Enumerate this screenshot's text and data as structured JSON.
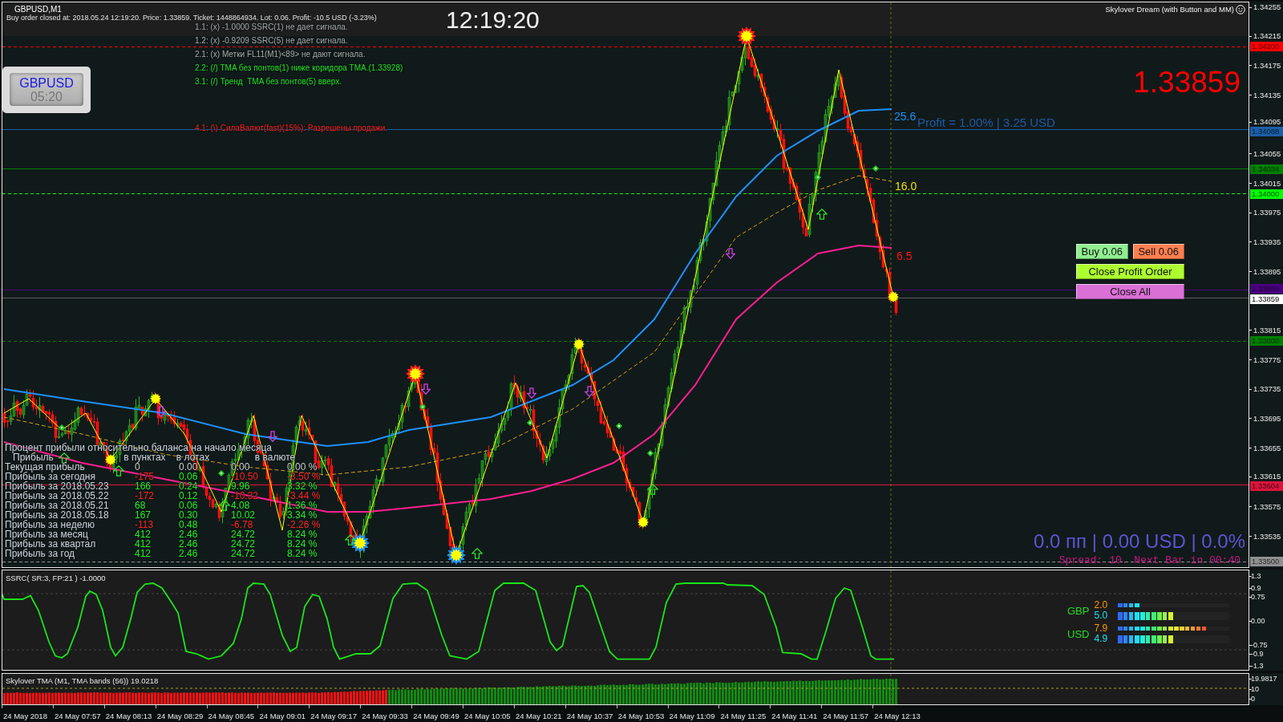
{
  "window": {
    "title": "GBPUSD,M1"
  },
  "order_message": "Buy order closed at: 2018.05.24 12:19:20. Price: 1.33859. Ticket: 1448864934. Lot: 0.06. Profit: -10.5 USD (-3.23%)",
  "clock": "12:19:20",
  "expert_title": "Skylover Dream (with Button and MM)",
  "signals": [
    {
      "text": "1.1: (x) -1.0000 SSRC(1) не дает сигнала.",
      "kind": "none"
    },
    {
      "text": "1.2: (x) -0.9209 SSRC(5) не дает сигнала.",
      "kind": "none"
    },
    {
      "text": "2.1: (x) Метки FL11(M1)<89> не дают сигнала.",
      "kind": "none"
    },
    {
      "text": "2.2: (/) TMA без понтов(1) ниже коридора TMA.(1.33928)",
      "kind": "up"
    },
    {
      "text": "3.1: (/) Тренд  TMA без понтов(5) вверх.",
      "kind": "up"
    }
  ],
  "strength_signal": {
    "text": "4.1: (\\) СилаВалют(fast)(15%): Разрешены продажи.",
    "kind": "down"
  },
  "symbol_panel": {
    "symbol": "GBPUSD",
    "countdown": "05:20"
  },
  "bid_price": "1.33859",
  "ma_labels": [
    {
      "text": "25.6",
      "color": "#1e90ff"
    },
    {
      "text": "16.0",
      "color": "#f0e000"
    },
    {
      "text": "6.5",
      "color": "#ff1010"
    }
  ],
  "profit_target": "Profit = 1.00% | 3.25 USD",
  "button_rows": [
    [
      {
        "label": "Buy 0.06",
        "color": "#90ee90"
      },
      {
        "label": "Sell 0.06",
        "color": "#ff7f50"
      }
    ],
    [
      {
        "label": "Close Profit Order",
        "color": "#adff2f"
      }
    ],
    [
      {
        "label": "Close All",
        "color": "#da70d6"
      }
    ]
  ],
  "profit_table": {
    "title": "Процент прибыли относительно баланса на начало месяца",
    "columns": [
      "Прибыль",
      "в пунктах",
      "в лотах",
      "в валюте"
    ],
    "rows": [
      {
        "kind": "neutral",
        "cells": [
          "Текущая прибыль",
          "0",
          "0.00",
          "0.00",
          "0.00 %"
        ]
      },
      {
        "kind": "loss",
        "cells": [
          "Прибыль за сегодня",
          "-175",
          "0.06",
          "-10.50",
          "-3.50 %"
        ]
      },
      {
        "kind": "gain",
        "cells": [
          "Прибыль за 2018.05.23",
          "166",
          "0.24",
          "9.96",
          "3.32 %"
        ]
      },
      {
        "kind": "loss",
        "cells": [
          "Прибыль за 2018.05.22",
          "-172",
          "0.12",
          "-10.32",
          "-3.44 %"
        ]
      },
      {
        "kind": "gain",
        "cells": [
          "Прибыль за 2018.05.21",
          "68",
          "0.06",
          "4.08",
          "1.36 %"
        ]
      },
      {
        "kind": "gain",
        "cells": [
          "Прибыль за 2018.05.18",
          "167",
          "0.30",
          "10.02",
          "3.34 %"
        ]
      },
      {
        "kind": "loss",
        "cells": [
          "Прибыль за неделю",
          "-113",
          "0.48",
          "-6.78",
          "-2.26 %"
        ]
      },
      {
        "kind": "gain",
        "cells": [
          "Прибыль за месяц",
          "412",
          "2.46",
          "24.72",
          "8.24 %"
        ]
      },
      {
        "kind": "gain",
        "cells": [
          "Прибыль за квартал",
          "412",
          "2.46",
          "24.72",
          "8.24 %"
        ]
      },
      {
        "kind": "gain",
        "cells": [
          "Прибыль за год",
          "412",
          "2.46",
          "24.72",
          "8.24 %"
        ]
      }
    ]
  },
  "pnl_summary": "0.0 пп | 0.00 USD | 0.0%",
  "spread_info": "Spread: 10. Next Bar in 00:40",
  "price_axis": {
    "ticks": [
      "1.34255",
      "1.34215",
      "1.34175",
      "1.34135",
      "1.34095",
      "1.34055",
      "1.34015",
      "1.33975",
      "1.33935",
      "1.33895",
      "1.33815",
      "1.33775",
      "1.33735",
      "1.33695",
      "1.33655",
      "1.33615",
      "1.33575",
      "1.33535"
    ],
    "levels": [
      {
        "label": "1.34200",
        "kind": "level",
        "color": "#ff0000",
        "dashed": true
      },
      {
        "label": "1.34088",
        "kind": "level",
        "color": "#1c5fa8",
        "dashed": false
      },
      {
        "label": "1.34034",
        "kind": "level",
        "color": "#008000",
        "dashed": false
      },
      {
        "label": "1.34000",
        "kind": "level",
        "color": "#00ff00",
        "dashed": true
      },
      {
        "label": "1.33869",
        "kind": "level",
        "color": "#4b0082",
        "dashed": false
      },
      {
        "label": "1.33859",
        "kind": "bid",
        "color": "#ffffff",
        "dashed": false
      },
      {
        "label": "1.33800",
        "kind": "level",
        "color": "#008000",
        "dashed": true
      },
      {
        "label": "1.33604",
        "kind": "level",
        "color": "#dc143c",
        "dashed": false
      },
      {
        "label": "1.33500",
        "kind": "level",
        "color": "#909090",
        "dashed": true
      }
    ]
  },
  "ssrc_pane": {
    "title": "SSRC( SR:3, FP:21 ) -1.0000",
    "ticks": [
      "1.3",
      "0.9",
      "0.75",
      "0.00",
      "-0.75",
      "-0.9",
      "-1.3"
    ],
    "currency_strength": [
      {
        "currency": "GBP",
        "rows": [
          {
            "value": "2.0",
            "kind": "fast",
            "level": 0.2
          },
          {
            "value": "5.0",
            "kind": "slow",
            "level": 0.5
          }
        ]
      },
      {
        "currency": "USD",
        "rows": [
          {
            "value": "7.9",
            "kind": "fast",
            "level": 0.79
          },
          {
            "value": "4.9",
            "kind": "slow",
            "level": 0.49
          }
        ]
      }
    ]
  },
  "tma_pane": {
    "title": "Skylover TMA (M1, TMA bands (56)) 19.0218",
    "ticks": [
      "19.9817",
      "10",
      "0"
    ]
  },
  "time_axis": [
    "24 May 2018",
    "24 May 07:57",
    "24 May 08:13",
    "24 May 08:29",
    "24 May 08:45",
    "24 May 09:01",
    "24 May 09:17",
    "24 May 09:33",
    "24 May 09:49",
    "24 May 10:05",
    "24 May 10:21",
    "24 May 10:37",
    "24 May 10:53",
    "24 May 11:09",
    "24 May 11:25",
    "24 May 11:41",
    "24 May 11:57",
    "24 May 12:13"
  ]
}
